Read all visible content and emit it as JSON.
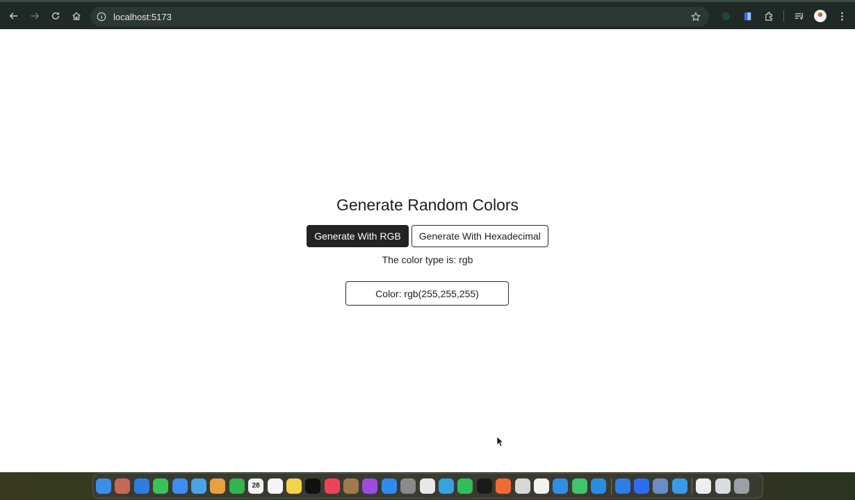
{
  "browser": {
    "url": "localhost:5173"
  },
  "page": {
    "title": "Generate Random Colors",
    "buttons": {
      "rgb_label": "Generate With RGB",
      "hex_label": "Generate With Hexadecimal"
    },
    "type_text": "The color type is: rgb",
    "color_text": "Color: rgb(255,255,255)",
    "current_color": "#ffffff"
  },
  "dock": {
    "calendar_day": "28",
    "apps": [
      {
        "name": "finder",
        "color": "#3b8ee8"
      },
      {
        "name": "launchpad",
        "color": "#c46a54"
      },
      {
        "name": "safari",
        "color": "#2f7de0"
      },
      {
        "name": "messages",
        "color": "#39c25a"
      },
      {
        "name": "mail",
        "color": "#3d8ef0"
      },
      {
        "name": "maps",
        "color": "#4aa2e8"
      },
      {
        "name": "photos",
        "color": "#e8a040"
      },
      {
        "name": "facetime",
        "color": "#31b54d"
      },
      {
        "name": "calendar",
        "color": "#f4f4f4"
      },
      {
        "name": "reminders",
        "color": "#f4f4f4"
      },
      {
        "name": "notes",
        "color": "#f4d24a"
      },
      {
        "name": "tv",
        "color": "#111111"
      },
      {
        "name": "music",
        "color": "#f0405a"
      },
      {
        "name": "contacts",
        "color": "#a07a4c"
      },
      {
        "name": "podcasts",
        "color": "#9e4ce0"
      },
      {
        "name": "app-store",
        "color": "#2d8cf0"
      },
      {
        "name": "system-settings",
        "color": "#8a8a8a"
      },
      {
        "name": "chrome",
        "color": "#e8e8e8"
      },
      {
        "name": "telegram",
        "color": "#34a4dc"
      },
      {
        "name": "whatsapp",
        "color": "#2fbe5a"
      },
      {
        "name": "terminal",
        "color": "#1a1a1a"
      },
      {
        "name": "postman",
        "color": "#f06a36"
      },
      {
        "name": "gitkraken",
        "color": "#d8d8d8"
      },
      {
        "name": "threads",
        "color": "#f2f2f2"
      },
      {
        "name": "vscode",
        "color": "#2f8fe0"
      },
      {
        "name": "thunder",
        "color": "#3fc66a"
      },
      {
        "name": "docker",
        "color": "#2a8ee0"
      }
    ],
    "apps_right": [
      {
        "name": "tasks",
        "color": "#2b7fe6"
      },
      {
        "name": "zoom",
        "color": "#2d6ef0"
      },
      {
        "name": "screen-share",
        "color": "#6a8cc8"
      },
      {
        "name": "xcode",
        "color": "#3a9ae8"
      }
    ],
    "apps_end": [
      {
        "name": "document",
        "color": "#eeeeee"
      },
      {
        "name": "preview",
        "color": "#d8dde2"
      },
      {
        "name": "trash",
        "color": "#9aa0a6"
      }
    ]
  }
}
